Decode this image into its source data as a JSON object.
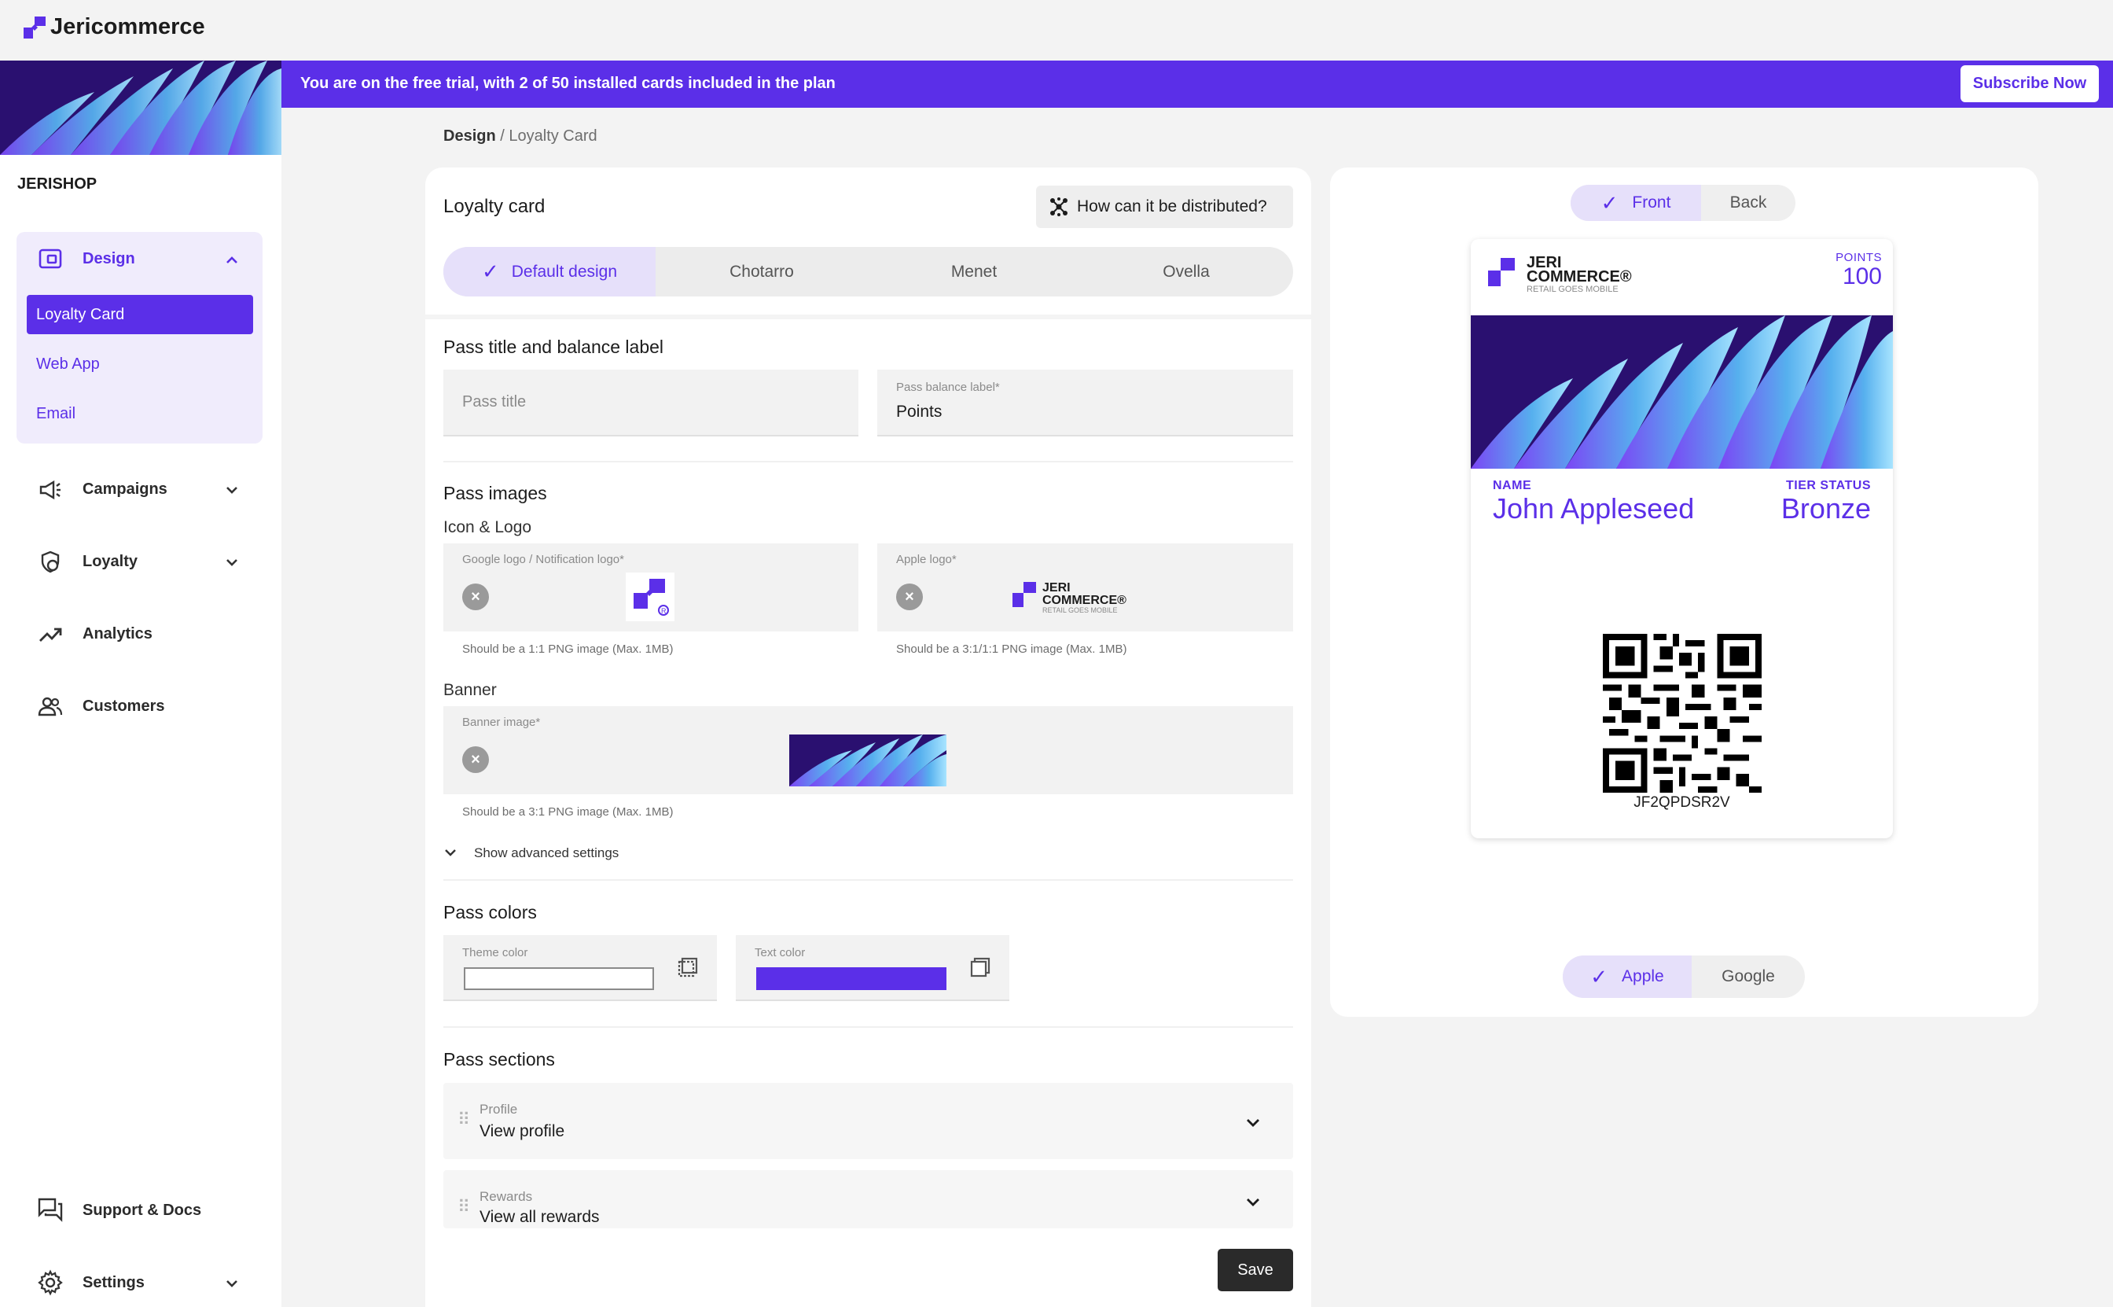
{
  "app": {
    "name": "Jericommerce"
  },
  "trial": {
    "message": "You are on the free trial, with 2 of 50 installed cards included in the plan",
    "subscribe_label": "Subscribe Now"
  },
  "sidebar": {
    "shop_name": "JERISHOP",
    "design": {
      "label": "Design",
      "items": [
        {
          "label": "Loyalty Card"
        },
        {
          "label": "Web App"
        },
        {
          "label": "Email"
        }
      ]
    },
    "items": [
      {
        "label": "Campaigns",
        "icon": "megaphone-icon"
      },
      {
        "label": "Loyalty",
        "icon": "loyalty-icon"
      },
      {
        "label": "Analytics",
        "icon": "trending-icon"
      },
      {
        "label": "Customers",
        "icon": "people-icon"
      }
    ],
    "bottom": [
      {
        "label": "Support & Docs",
        "icon": "chat-icon"
      },
      {
        "label": "Settings",
        "icon": "gear-icon"
      }
    ]
  },
  "breadcrumb": {
    "root": "Design",
    "separator": "/",
    "current": "Loyalty Card"
  },
  "form": {
    "title": "Loyalty card",
    "distribute_label": "How can it be distributed?",
    "tabs": [
      "Default design",
      "Chotarro",
      "Menet",
      "Ovella"
    ],
    "pass_title_section": "Pass title and balance label",
    "pass_title_placeholder": "Pass title",
    "balance_label": "Pass balance label*",
    "balance_value": "Points",
    "images_section": "Pass images",
    "icon_logo": "Icon & Logo",
    "google_logo_label": "Google logo / Notification logo*",
    "google_logo_hint": "Should be a 1:1 PNG image (Max. 1MB)",
    "apple_logo_label": "Apple logo*",
    "apple_logo_hint": "Should be a 3:1/1:1 PNG image (Max. 1MB)",
    "banner_heading": "Banner",
    "banner_label": "Banner image*",
    "banner_hint": "Should be a 3:1 PNG image (Max. 1MB)",
    "advanced": "Show advanced settings",
    "colors_section": "Pass colors",
    "theme_color_label": "Theme color",
    "text_color_label": "Text color",
    "theme_color": "#ffffff",
    "text_color": "#5b2fe8",
    "sections_heading": "Pass sections",
    "sections": [
      {
        "label": "Profile",
        "value": "View profile"
      },
      {
        "label": "Rewards",
        "value": "View all rewards"
      }
    ],
    "save_label": "Save"
  },
  "preview": {
    "side_toggle": [
      "Front",
      "Back"
    ],
    "platform_toggle": [
      "Apple",
      "Google"
    ],
    "card": {
      "logo_line1": "JERI",
      "logo_line2": "COMMERCE®",
      "logo_tagline": "RETAIL GOES MOBILE",
      "points_label": "POINTS",
      "points_value": "100",
      "name_label": "NAME",
      "name_value": "John Appleseed",
      "tier_label": "TIER STATUS",
      "tier_value": "Bronze",
      "code": "JF2QPDSR2V"
    }
  },
  "colors": {
    "accent": "#5b2fe8"
  }
}
